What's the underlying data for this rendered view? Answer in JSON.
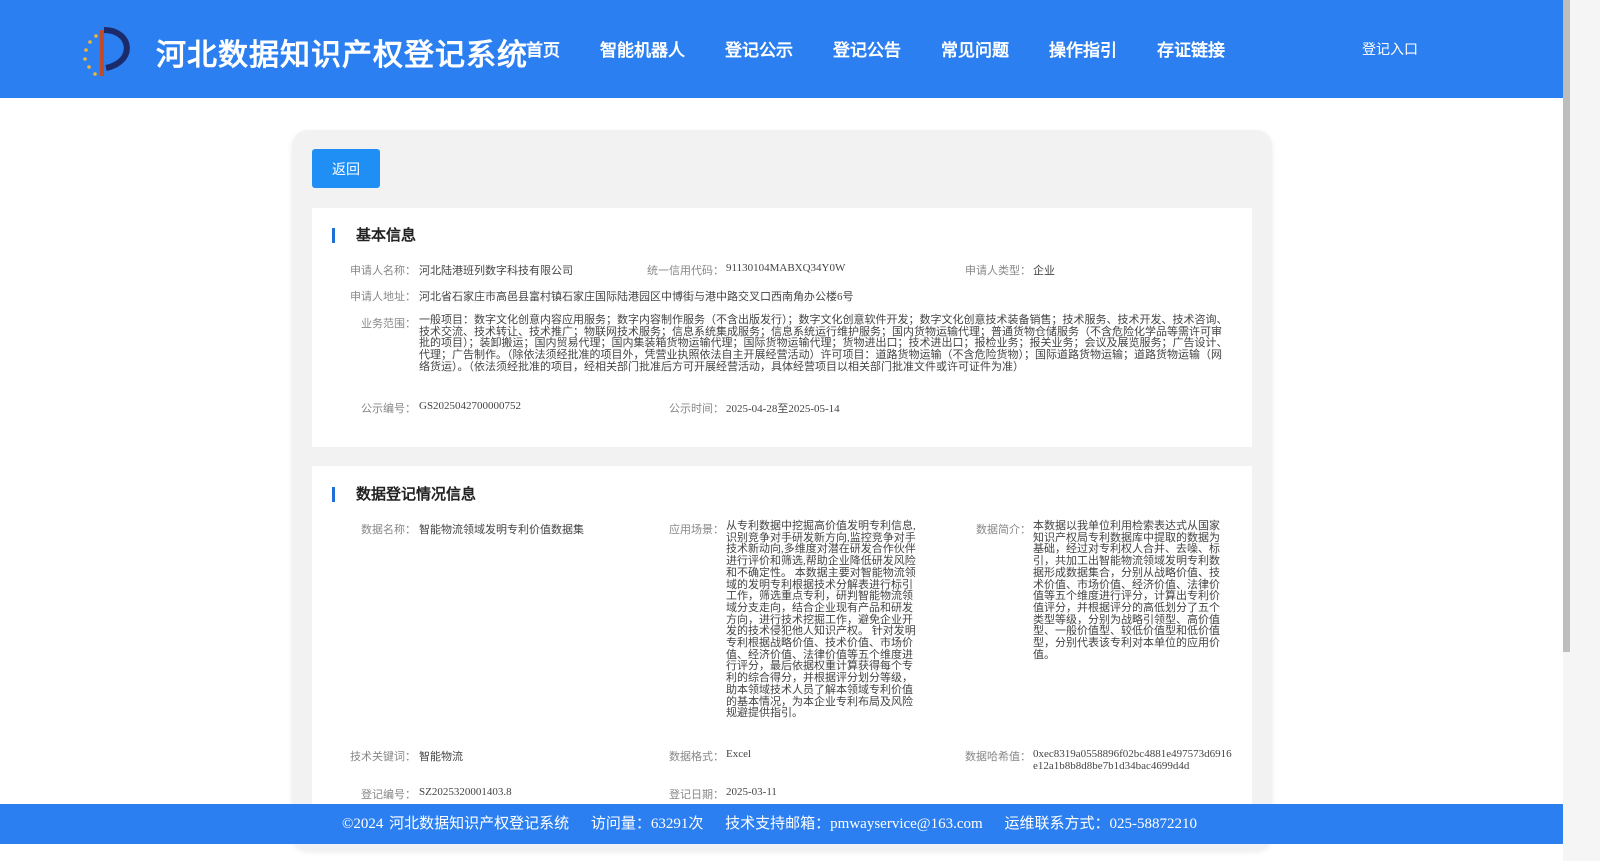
{
  "header": {
    "title": "河北数据知识产权登记系统",
    "nav": [
      "首页",
      "智能机器人",
      "登记公示",
      "登记公告",
      "常见问题",
      "操作指引",
      "存证链接"
    ],
    "login": "登记入口"
  },
  "back_label": "返回",
  "basic": {
    "title": "基本信息",
    "applicant_name_label": "申请人名称：",
    "applicant_name": "河北陆港班列数字科技有限公司",
    "credit_code_label": "统一信用代码：",
    "credit_code": "91130104MABXQ34Y0W",
    "applicant_type_label": "申请人类型：",
    "applicant_type": "企业",
    "address_label": "申请人地址：",
    "address": "河北省石家庄市高邑县富村镇石家庄国际陆港园区中博街与港中路交叉口西南角办公楼6号",
    "scope_label": "业务范围：",
    "scope": "一般项目：数字文化创意内容应用服务；数字内容制作服务（不含出版发行）；数字文化创意软件开发；数字文化创意技术装备销售；技术服务、技术开发、技术咨询、技术交流、技术转让、技术推广；物联网技术服务；信息系统集成服务；信息系统运行维护服务；国内货物运输代理；普通货物仓储服务（不含危险化学品等需许可审批的项目）；装卸搬运；国内贸易代理；国内集装箱货物运输代理；国际货物运输代理；货物进出口；技术进出口；报检业务；报关业务；会议及展览服务；广告设计、代理；广告制作。（除依法须经批准的项目外，凭营业执照依法自主开展经营活动）许可项目：道路货物运输（不含危险货物）；国际道路货物运输；道路货物运输（网络货运）。（依法须经批准的项目，经相关部门批准后方可开展经营活动，具体经营项目以相关部门批准文件或许可证件为准）",
    "notice_no_label": "公示编号：",
    "notice_no": "GS2025042700000752",
    "notice_time_label": "公示时间：",
    "notice_time": "2025-04-28至2025-05-14"
  },
  "data": {
    "title": "数据登记情况信息",
    "name_label": "数据名称：",
    "name": "智能物流领域发明专利价值数据集",
    "scene_label": "应用场景：",
    "scene": "从专利数据中挖掘高价值发明专利信息,识别竞争对手研发新方向,监控竞争对手技术新动向,多维度对潜在研发合作伙伴进行评价和筛选,帮助企业降低研发风险和不确定性。 本数据主要对智能物流领域的发明专利根据技术分解表进行标引工作，筛选重点专利，研判智能物流领域分支走向，结合企业现有产品和研发方向，进行技术挖掘工作，避免企业开发的技术侵犯他人知识产权。 针对发明专利根据战略价值、技术价值、市场价值、经济价值、法律价值等五个维度进行评分，最后依据权重计算获得每个专利的综合得分，并根据评分划分等级，助本领域技术人员了解本领域专利价值的基本情况，为本企业专利布局及风险规避提供指引。",
    "intro_label": "数据简介：",
    "intro": "本数据以我单位利用检索表达式从国家知识产权局专利数据库中提取的数据为基础，经过对专利权人合并、去噪、标引，共加工出智能物流领域发明专利数据形成数据集合，分别从战略价值、技术价值、市场价值、经济价值、法律价值等五个维度进行评分，计算出专利价值评分，并根据评分的高低划分了五个类型等级，分别为战略引领型、高价值型、一般价值型、较低价值型和低价值型，分别代表该专利对本单位的应用价值。",
    "keyword_label": "技术关键词：",
    "keyword": "智能物流",
    "format_label": "数据格式：",
    "format": "Excel",
    "hash_label": "数据哈希值：",
    "hash": "0xec8319a0558896f02bc4881e497573d6916e12a1b8b8d8be7b1d34bac4699d4d",
    "reg_no_label": "登记编号：",
    "reg_no": "SZ2025320001403.8",
    "reg_date_label": "登记日期：",
    "reg_date": "2025-03-11"
  },
  "footer": {
    "copyright": "©2024 河北数据知识产权登记系统",
    "visits": "访问量：63291次",
    "email": "技术支持邮箱：pmwayservice@163.com",
    "phone": "运维联系方式：025-58872210"
  },
  "colors": {
    "header_bg": "#2b7ff0",
    "button_bg": "#1f8ff5",
    "section_bar": "#1f6fd6"
  }
}
